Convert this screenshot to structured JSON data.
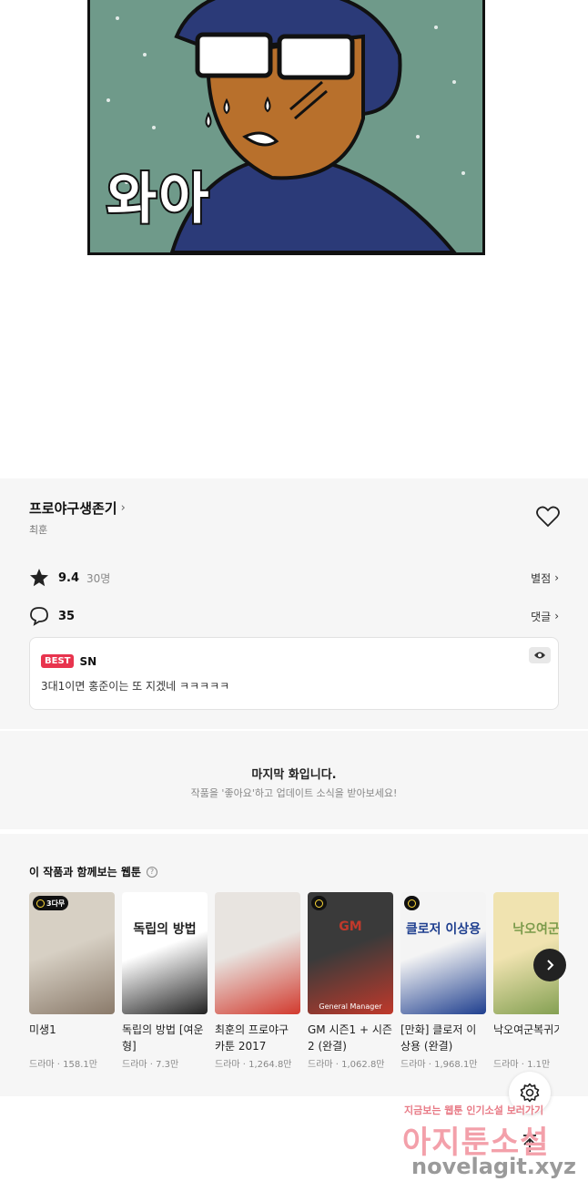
{
  "comic": {
    "panel_text": "와아"
  },
  "episode_info": {
    "title": "프로야구생존기",
    "author": "최훈",
    "rating_value": "9.4",
    "rating_count": "30명",
    "rating_link": "별점",
    "comment_count": "35",
    "comment_link": "댓글",
    "best_comment": {
      "badge": "BEST",
      "user": "SN",
      "text": "3대1이면 홍준이는 또 지겠네 ㅋㅋㅋㅋㅋ"
    }
  },
  "last_episode": {
    "title": "마지막 화입니다.",
    "subtitle": "작품을 '좋아요'하고 업데이트 소식을 받아보세요!"
  },
  "recommendations": {
    "title": "이 작품과 함께보는 웹툰",
    "items": [
      {
        "name": "미생1",
        "meta": "드라마 · 158.1만",
        "badge": "3다무",
        "colors": [
          "#d7d0c4",
          "#8a7a6a"
        ]
      },
      {
        "name": "독립의 방법 [여운형]",
        "meta": "드라마 · 7.3만",
        "badge": "",
        "thumb_text": "독립의 방법",
        "colors": [
          "#ffffff",
          "#222222"
        ]
      },
      {
        "name": "최훈의 프로야구 카툰 2017",
        "meta": "드라마 · 1,264.8만",
        "badge": "",
        "colors": [
          "#e8e4e0",
          "#d23a2e"
        ]
      },
      {
        "name": "GM 시즌1 + 시즌2 (완결)",
        "meta": "드라마 · 1,062.8만",
        "badge": "clock",
        "thumb_text": "GM",
        "thumb_sub": "General Manager",
        "colors": [
          "#3a3a3a",
          "#c0392b"
        ]
      },
      {
        "name": "[만화] 클로저 이상용 (완결)",
        "meta": "드라마 · 1,968.1만",
        "badge": "clock",
        "thumb_text": "클로저 이상용",
        "colors": [
          "#f4f4f4",
          "#1f3f8f"
        ]
      },
      {
        "name": "낙오여군복귀기",
        "meta": "드라마 · 1.1만",
        "badge": "",
        "thumb_text": "낙오여군",
        "colors": [
          "#f0e3b0",
          "#7a9a4a"
        ]
      }
    ]
  },
  "watermark": {
    "line1": "지금보는 웹툰 인기소설 보러가기",
    "line2": "아지툰소설",
    "line3": "novelagit.xyz"
  },
  "accent_color": "#e8344e"
}
